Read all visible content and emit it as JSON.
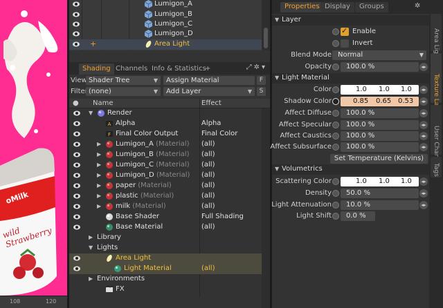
{
  "viewport": {
    "ruler_ticks": [
      "108",
      "120"
    ],
    "product_text": "Milk",
    "product_subtext": "wild Strawberry",
    "logo_text": "oMilk"
  },
  "items": [
    {
      "label": "Lumigon_A"
    },
    {
      "label": "Lumigon_B"
    },
    {
      "label": "Lumigon_C"
    },
    {
      "label": "Lumigon_D"
    },
    {
      "label": "Area Light"
    }
  ],
  "shading": {
    "tabs": [
      "Shading",
      "Channels",
      "Info & Statistics",
      "+"
    ],
    "view_label": "View",
    "view_value": "Shader Tree",
    "assign_button": "Assign Material",
    "filter_label": "Filter",
    "filter_value": "(none)",
    "add_layer": "Add Layer",
    "f_button": "F",
    "s_button": "S",
    "col_name": "Name",
    "col_effect": "Effect",
    "rows": [
      {
        "name": "Render",
        "sub": "",
        "effect": ""
      },
      {
        "name": "Alpha",
        "sub": "",
        "effect": "Alpha"
      },
      {
        "name": "Final Color Output",
        "sub": "",
        "effect": "Final Color"
      },
      {
        "name": "Lumigon_A",
        "sub": "(Material)",
        "effect": "(all)"
      },
      {
        "name": "Lumigon_B",
        "sub": "(Material)",
        "effect": "(all)"
      },
      {
        "name": "Lumigon_C",
        "sub": "(Material)",
        "effect": "(all)"
      },
      {
        "name": "Lumigon_D",
        "sub": "(Material)",
        "effect": "(all)"
      },
      {
        "name": "paper",
        "sub": "(Material)",
        "effect": "(all)"
      },
      {
        "name": "plastic",
        "sub": "(Material)",
        "effect": "(all)"
      },
      {
        "name": "milk",
        "sub": "(Material)",
        "effect": "(all)"
      },
      {
        "name": "Base Shader",
        "sub": "",
        "effect": "Full Shading"
      },
      {
        "name": "Base Material",
        "sub": "",
        "effect": "(all)"
      },
      {
        "name": "Library",
        "sub": "",
        "effect": ""
      },
      {
        "name": "Lights",
        "sub": "",
        "effect": ""
      },
      {
        "name": "Area Light",
        "sub": "",
        "effect": ""
      },
      {
        "name": "Light Material",
        "sub": "",
        "effect": "(all)"
      },
      {
        "name": "Environments",
        "sub": "",
        "effect": ""
      },
      {
        "name": "FX",
        "sub": "",
        "effect": ""
      }
    ]
  },
  "properties": {
    "tabs": [
      "Properties",
      "Display",
      "Groups"
    ],
    "side_tabs": [
      "Area Light",
      "Texture Layers",
      "User Channels",
      "Tags"
    ],
    "layer_section": "Layer",
    "enable_label": "Enable",
    "invert_label": "Invert",
    "blend_mode_label": "Blend Mode",
    "blend_mode_value": "Normal",
    "opacity_label": "Opacity",
    "opacity_value": "100.0 %",
    "light_material_section": "Light Material",
    "color_label": "Color",
    "color_values": [
      "1.0",
      "1.0",
      "1.0"
    ],
    "shadow_color_label": "Shadow Color",
    "shadow_color_values": [
      "0.85",
      "0.65",
      "0.53"
    ],
    "affect_diffuse_label": "Affect Diffuse",
    "affect_diffuse_value": "100.0 %",
    "affect_specular_label": "Affect Specular",
    "affect_specular_value": "100.0 %",
    "affect_caustics_label": "Affect Caustics",
    "affect_caustics_value": "100.0 %",
    "affect_subsurface_label": "Affect Subsurface",
    "affect_subsurface_value": "100.0 %",
    "set_temperature_button": "Set Temperature (Kelvins)",
    "volumetrics_section": "Volumetrics",
    "scattering_color_label": "Scattering Color",
    "scattering_color_values": [
      "1.0",
      "1.0",
      "1.0"
    ],
    "density_label": "Density",
    "density_value": "50.0 %",
    "light_attenuation_label": "Light Attenuation",
    "light_attenuation_value": "10.0 %",
    "light_shift_label": "Light Shift",
    "light_shift_value": "0.0 %"
  },
  "colors": {
    "viewport_bg": "#ff2d92",
    "accent": "#f0a030",
    "shadow_color": "#f0c8a8"
  }
}
